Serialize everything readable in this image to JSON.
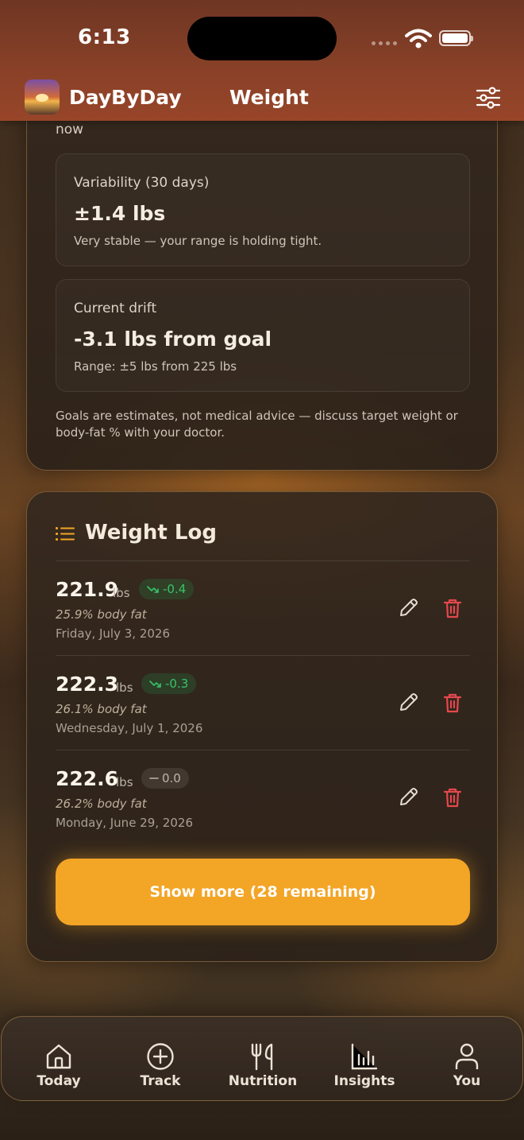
{
  "status_bar": {
    "time": "6:13"
  },
  "header": {
    "app_name": "DayByDay",
    "title": "Weight"
  },
  "goal_card": {
    "now_text": "now",
    "variability": {
      "label": "Variability (30 days)",
      "value": "±1.4 lbs",
      "note": "Very stable — your range is holding tight."
    },
    "drift": {
      "label": "Current drift",
      "value": "-3.1 lbs from goal",
      "note": "Range: ±5 lbs from 225 lbs"
    },
    "disclaimer": "Goals are estimates, not medical advice — discuss target weight or body-fat % with your doctor."
  },
  "weight_log": {
    "title": "Weight Log",
    "entries": [
      {
        "weight": "221.9",
        "unit": "lbs",
        "delta": "-0.4",
        "delta_direction": "down",
        "body_fat": "25.9% body fat",
        "date": "Friday, July 3, 2026"
      },
      {
        "weight": "222.3",
        "unit": "lbs",
        "delta": "-0.3",
        "delta_direction": "down",
        "body_fat": "26.1% body fat",
        "date": "Wednesday, July 1, 2026"
      },
      {
        "weight": "222.6",
        "unit": "lbs",
        "delta": "0.0",
        "delta_direction": "flat",
        "body_fat": "26.2% body fat",
        "date": "Monday, June 29, 2026"
      }
    ],
    "show_more_label": "Show more (28 remaining)"
  },
  "tabs": [
    {
      "label": "Today",
      "icon": "home-icon"
    },
    {
      "label": "Track",
      "icon": "plus-circle-icon"
    },
    {
      "label": "Nutrition",
      "icon": "fork-knife-icon"
    },
    {
      "label": "Insights",
      "icon": "bar-chart-icon"
    },
    {
      "label": "You",
      "icon": "person-icon"
    }
  ],
  "colors": {
    "header": "#974529",
    "accent": "#f3a526",
    "delta_down": "#37c26a",
    "delete": "#e5484d",
    "card_border": "#c4965a"
  }
}
